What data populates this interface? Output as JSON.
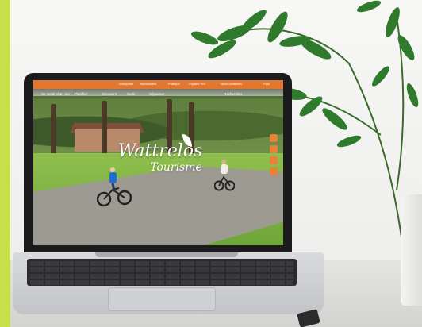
{
  "colors": {
    "accent_bar": "#c7e04a",
    "site_orange": "#e2772f",
    "laptop_frame": "#1b1b1d",
    "plant_leaf": "#2f7a2c"
  },
  "website": {
    "topbar_links": [
      "Entreprise",
      "Nouveautes",
      "Pratique",
      "Espace Pro",
      "Nous contacter",
      "Plan"
    ],
    "nav_items": [
      "Se sentir chez soi",
      "Planifier",
      "Découvrir",
      "Sortir",
      "Séjourner"
    ],
    "nav_search": "Rechercher",
    "logo_title": "Wattrelos",
    "logo_subtitle": "Tourisme",
    "social_icons": [
      "facebook-icon",
      "instagram-icon",
      "youtube-icon",
      "share-icon"
    ]
  }
}
